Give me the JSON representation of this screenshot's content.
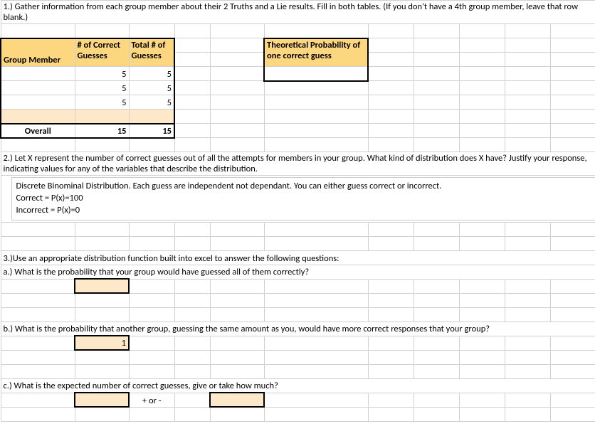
{
  "q1": {
    "text": "1.) Gather information from each group member about their 2 Truths and a Lie results.  Fill in both tables.  (If you don't have a 4th group member, leave that row blank.)",
    "left_headers": {
      "group_member": "Group Member",
      "correct": "# of Correct Guesses",
      "total": "Total # of Guesses"
    },
    "rows": [
      {
        "member": "",
        "correct": "5",
        "total": "5"
      },
      {
        "member": "",
        "correct": "5",
        "total": "5"
      },
      {
        "member": "",
        "correct": "5",
        "total": "5"
      },
      {
        "member": "",
        "correct": "",
        "total": ""
      }
    ],
    "overall": {
      "label": "Overall",
      "correct": "15",
      "total": "15"
    },
    "right_header": "Theoretical Probability of one correct guess",
    "right_value": ""
  },
  "q2": {
    "text": "2.) Let X represent the number of correct guesses out of all the attempts for members in your group.  What kind of distribution does X have?  Justify your response, indicating values for any of the variables that describe the distribution.",
    "answer_line1": "Discrete Binominal Distribution. Each guess are independent not dependant. You can either guess correct or incorrect.",
    "answer_line2": "Correct = P(x)=100",
    "answer_line3": "Incorrect = P(x)=0"
  },
  "q3": {
    "text": "3.)Use an appropriate distribution function built into excel to answer the following questions:",
    "a": {
      "text": "a.) What is the probability that your group would have guessed all of them correctly?",
      "value": ""
    },
    "b": {
      "text": "b.) What is the probability that another group, guessing the same amount as you, would have more correct responses that your group?",
      "value": "1"
    },
    "c": {
      "text": "c.) What is the expected number of correct guesses, give or take how much?",
      "value1": "",
      "sep": "+ or -",
      "value2": ""
    }
  }
}
